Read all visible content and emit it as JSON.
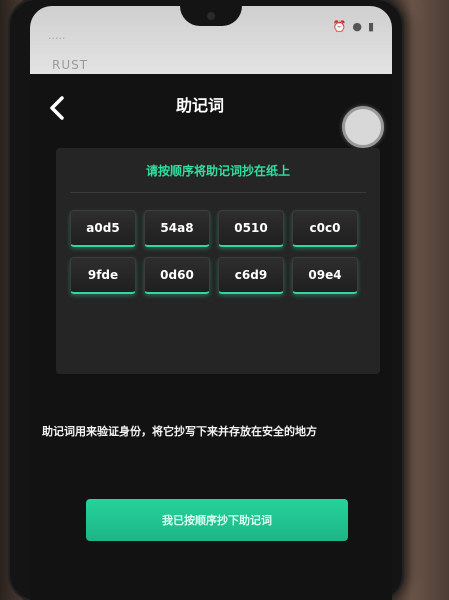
{
  "statusbar": {
    "carrier": "·····",
    "sub_carrier": "RUST",
    "icons": [
      "alarm-icon",
      "signal-icon",
      "battery-icon"
    ]
  },
  "header": {
    "title": "助记词",
    "back_icon": "chevron-left-icon"
  },
  "card": {
    "instruction": "请按顺序将助记词抄在纸上",
    "words": [
      "a0d5",
      "54a8",
      "0510",
      "c0c0",
      "9fde",
      "0d60",
      "c6d9",
      "09e4"
    ]
  },
  "note": "助记词用来验证身份，将它抄写下来并存放在安全的地方",
  "confirm_button": "我已按顺序抄下助记词",
  "colors": {
    "accent": "#2ee0a0",
    "button": "#1db585",
    "background": "#121212",
    "card": "#252525"
  }
}
